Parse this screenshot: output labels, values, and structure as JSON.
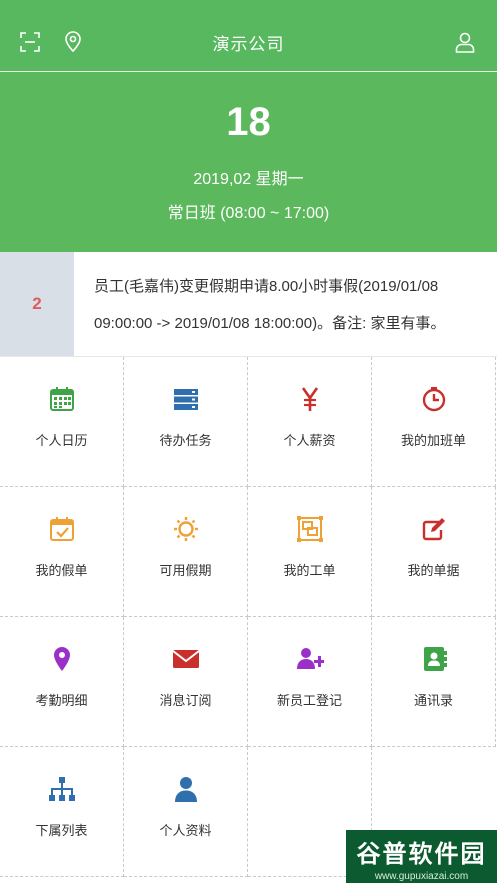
{
  "header": {
    "title": "演示公司",
    "icons": [
      "scan-icon",
      "location-icon",
      "user-icon"
    ]
  },
  "date_panel": {
    "day": "18",
    "date_line": "2019,02 星期一",
    "shift": "常日班 (08:00 ~ 17:00)"
  },
  "notice": {
    "count": "2",
    "text": "员工(毛嘉伟)变更假期申请8.00小时事假(2019/01/08 09:00:00 -> 2019/01/08 18:00:00)。备注: 家里有事。"
  },
  "menu": {
    "items": [
      {
        "label": "个人日历",
        "icon": "calendar-icon",
        "color": "#3fa348"
      },
      {
        "label": "待办任务",
        "icon": "task-list-icon",
        "color": "#2f6fad"
      },
      {
        "label": "个人薪资",
        "icon": "yen-icon",
        "color": "#c9302c"
      },
      {
        "label": "我的加班单",
        "icon": "clock-icon",
        "color": "#c9302c"
      },
      {
        "label": "我的假单",
        "icon": "calendar-check-icon",
        "color": "#eea236"
      },
      {
        "label": "可用假期",
        "icon": "sun-icon",
        "color": "#eea236"
      },
      {
        "label": "我的工单",
        "icon": "work-order-icon",
        "color": "#eea236"
      },
      {
        "label": "我的单据",
        "icon": "edit-icon",
        "color": "#c9302c"
      },
      {
        "label": "考勤明细",
        "icon": "map-marker-icon",
        "color": "#9b30c9"
      },
      {
        "label": "消息订阅",
        "icon": "envelope-icon",
        "color": "#c9302c"
      },
      {
        "label": "新员工登记",
        "icon": "add-user-icon",
        "color": "#9b30c9"
      },
      {
        "label": "通讯录",
        "icon": "address-book-icon",
        "color": "#3fa348"
      },
      {
        "label": "下属列表",
        "icon": "org-chart-icon",
        "color": "#2f6fad"
      },
      {
        "label": "个人资料",
        "icon": "profile-icon",
        "color": "#2f6fad"
      }
    ]
  },
  "watermark": {
    "text": "谷普软件园",
    "url": "www.gupuxiazai.com"
  }
}
